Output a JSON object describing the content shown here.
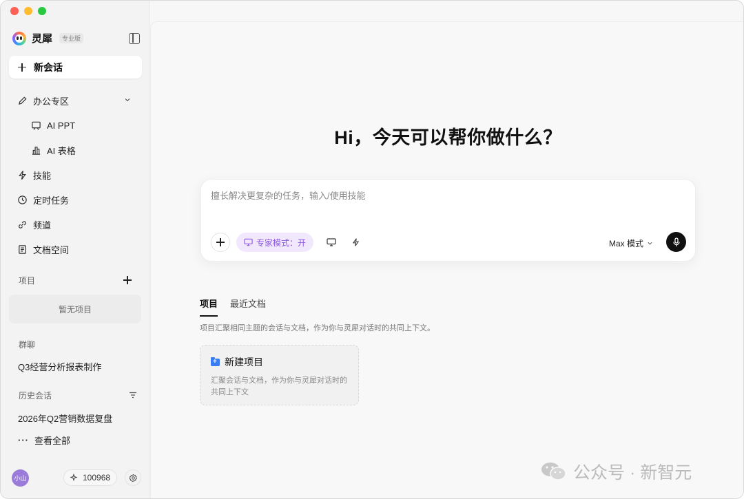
{
  "window": {
    "controls": [
      "close",
      "minimize",
      "zoom"
    ]
  },
  "sidebar": {
    "brand_name": "灵犀",
    "brand_badge": "专业版",
    "new_chat_label": "新会话",
    "nav": {
      "office_label": "办公专区",
      "ai_ppt_label": "AI PPT",
      "ai_table_label": "AI 表格",
      "skills_label": "技能",
      "scheduled_label": "定时任务",
      "channels_label": "频道",
      "docs_label": "文档空间"
    },
    "projects_section": "项目",
    "projects_empty": "暂无项目",
    "group_section": "群聊",
    "group_item": "Q3经营分析报表制作",
    "history_section": "历史会话",
    "history_item": "2026年Q2营销数据复盘",
    "view_all_label": "查看全部",
    "user_avatar": "小山",
    "credits": "100968"
  },
  "main": {
    "greeting": "Hi，今天可以帮你做什么？",
    "composer": {
      "placeholder": "擅长解决更复杂的任务，输入/使用技能",
      "expert_mode": "专家模式：开",
      "model": "Max 模式"
    },
    "tabs": [
      "项目",
      "最近文档"
    ],
    "tab_desc": "项目汇聚相同主题的会话与文档，作为你与灵犀对话时的共同上下文。",
    "new_project_title": "新建项目",
    "new_project_desc": "汇聚会话与文档，作为你与灵犀对话时的共同上下文"
  },
  "watermark": "公众号 · 新智元",
  "colors": {
    "accent_purple": "#8b58e0",
    "expert_bg": "#f1e8fd",
    "folder_blue": "#3a7cf2",
    "avatar_purple": "#9b7bd9"
  }
}
